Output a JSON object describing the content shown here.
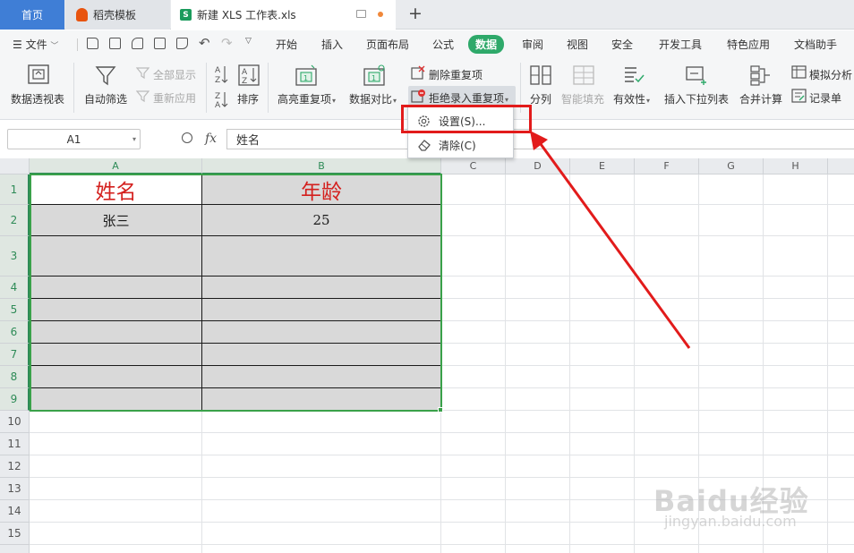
{
  "tabs": {
    "home": "首页",
    "template": "稻壳模板",
    "document": "新建 XLS 工作表.xls",
    "doc_logo_letter": "S"
  },
  "menu": {
    "file": "文件",
    "items": [
      "开始",
      "插入",
      "页面布局",
      "公式",
      "数据",
      "审阅",
      "视图",
      "安全",
      "开发工具",
      "特色应用",
      "文档助手"
    ],
    "active_index": 4
  },
  "ribbon": {
    "pivot": "数据透视表",
    "autofilter": "自动筛选",
    "show_all": "全部显示",
    "reapply": "重新应用",
    "sort": "排序",
    "highlight_dup": "高亮重复项",
    "compare": "数据对比",
    "delete_dup": "删除重复项",
    "reject_dup": "拒绝录入重复项",
    "split": "分列",
    "flash_fill": "智能填充",
    "validity": "有效性",
    "insert_dropdown": "插入下拉列表",
    "consolidate": "合并计算",
    "simulate": "模拟分析",
    "record": "记录单"
  },
  "formula_bar": {
    "cell_ref": "A1",
    "fx": "fx",
    "content": "姓名"
  },
  "dropdown": {
    "settings": "设置(S)...",
    "clear": "清除(C)"
  },
  "grid": {
    "columns": [
      "A",
      "B",
      "C",
      "D",
      "E",
      "F",
      "G",
      "H"
    ],
    "rows": [
      "1",
      "2",
      "3",
      "4",
      "5",
      "6",
      "7",
      "8",
      "9",
      "10",
      "11",
      "12",
      "13",
      "14",
      "15"
    ],
    "cells": {
      "A1": "姓名",
      "B1": "年龄",
      "A2": "张三",
      "B2": "25"
    }
  },
  "watermark": {
    "brand": "Baidu经验",
    "url": "jingyan.baidu.com"
  },
  "colors": {
    "accent_green": "#2ea96a",
    "header_red": "#d4201e",
    "annotation_red": "#e21b1b",
    "tab_blue": "#3f7ed6"
  }
}
